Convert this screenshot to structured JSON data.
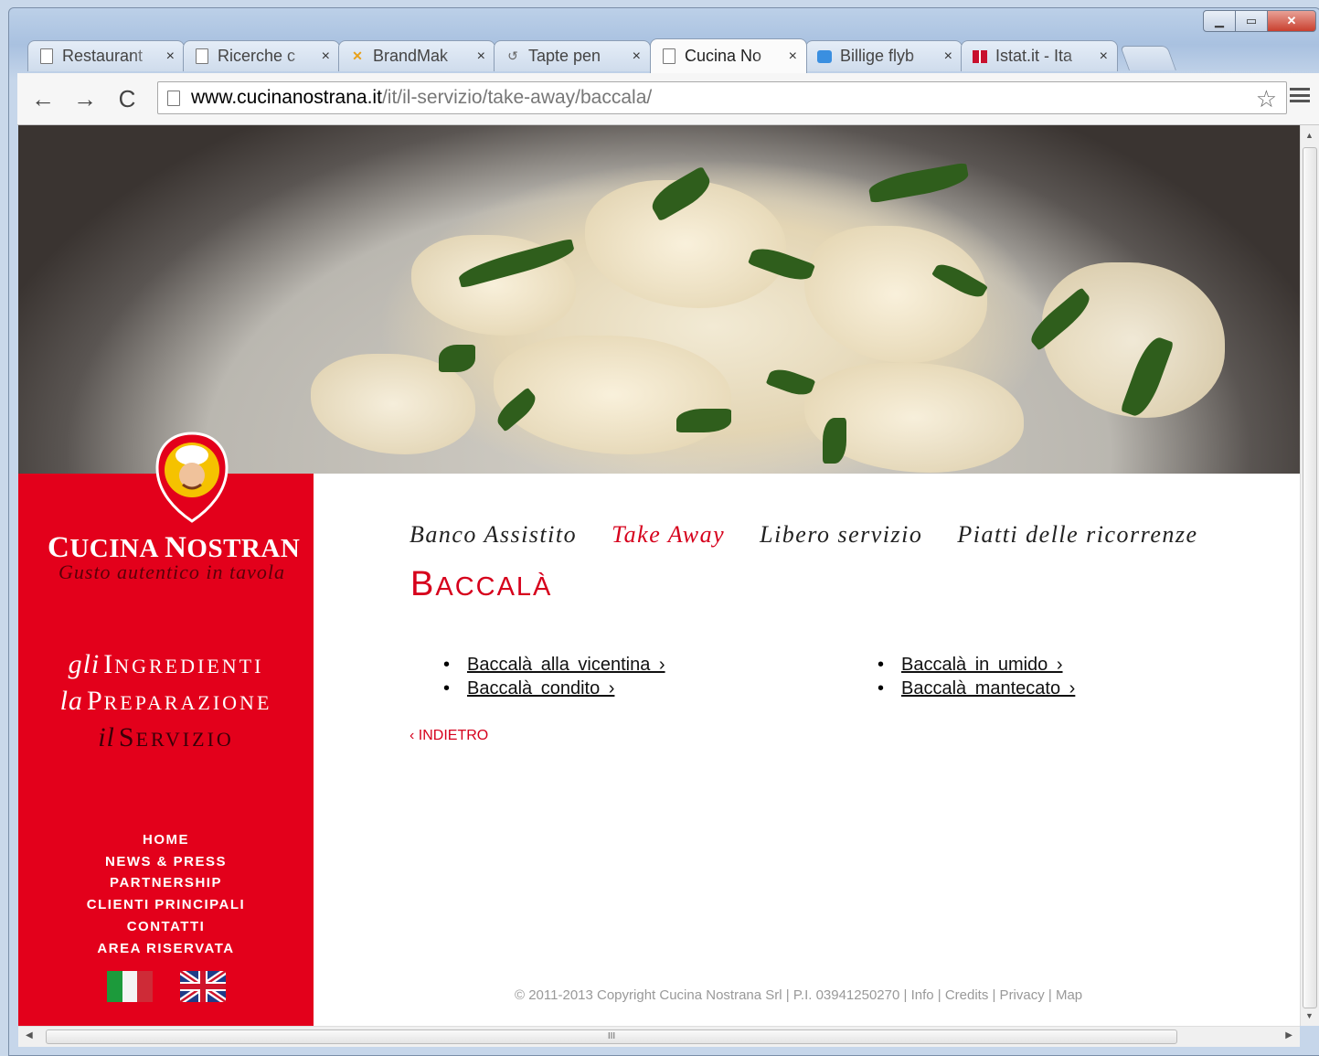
{
  "browser": {
    "tabs": [
      {
        "title": "Restaurant",
        "icon": "doc"
      },
      {
        "title": "Ricerche c",
        "icon": "doc"
      },
      {
        "title": "BrandMak",
        "icon": "brandmaker"
      },
      {
        "title": "Tapte pen",
        "icon": "loading"
      },
      {
        "title": "Cucina No",
        "icon": "doc",
        "active": true
      },
      {
        "title": "Billige flyb",
        "icon": "flight"
      },
      {
        "title": "Istat.it - Ita",
        "icon": "istat"
      }
    ],
    "close_glyph": "×",
    "url_host": "www.cucinanostrana.it",
    "url_path": "/it/il-servizio/take-away/baccala/"
  },
  "site": {
    "brand_cucina": "C",
    "brand_rest1": "UCINA ",
    "brand_nostrana_n": "N",
    "brand_rest2": "OSTRAN",
    "tagline": "Gusto autentico in tavola",
    "motto": [
      {
        "article": "gli",
        "initial": "I",
        "rest": "NGREDIENTI"
      },
      {
        "article": "la",
        "initial": "P",
        "rest": "REPARAZIONE"
      },
      {
        "article": "il",
        "initial": "S",
        "rest": "ERVIZIO"
      }
    ],
    "menu": [
      "HOME",
      "NEWS & PRESS",
      "PARTNERSHIP",
      "CLIENTI PRINCIPALI",
      "CONTATTI",
      "AREA RISERVATA"
    ],
    "nav_tabs": [
      "Banco Assistito",
      "Take Away",
      "Libero servizio",
      "Piatti delle ricorrenze"
    ],
    "current_tab_index": 1,
    "title_initial": "B",
    "title_rest": "ACCALÀ",
    "dishes_left": [
      "Baccalà alla vicentina ›",
      "Baccalà condito ›"
    ],
    "dishes_right": [
      "Baccalà in umido ›",
      "Baccalà mantecato ›"
    ],
    "back_label": "‹  INDIETRO",
    "footer": "© 2011-2013 Copyright Cucina Nostrana Srl | P.I. 03941250270 | Info | Credits | Privacy | Map",
    "accent_color": "#e3001b"
  }
}
